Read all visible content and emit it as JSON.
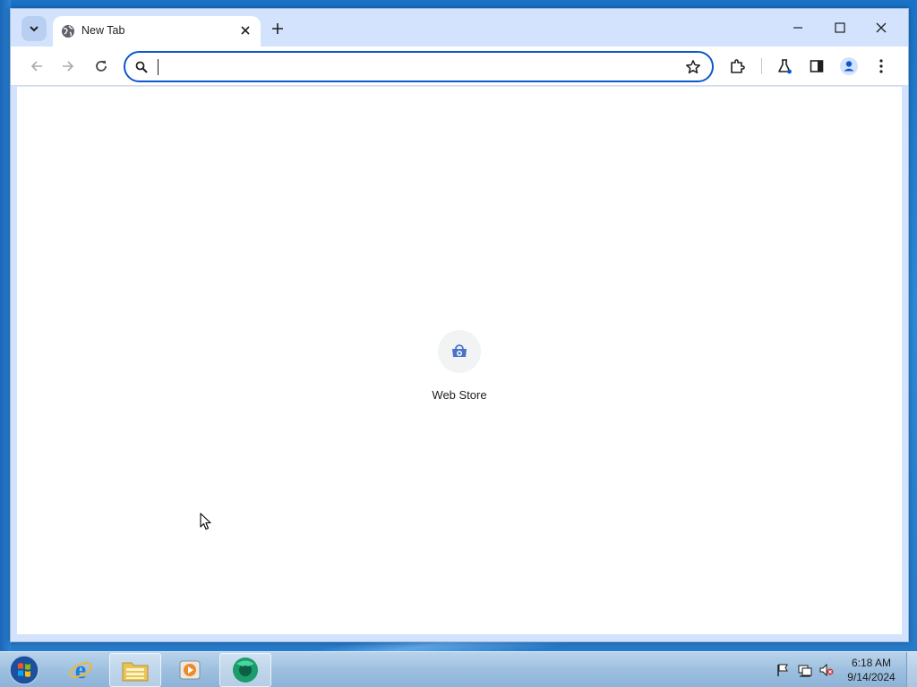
{
  "browser": {
    "tab": {
      "title": "New Tab"
    },
    "omnibox": {
      "value": "",
      "placeholder": ""
    },
    "icons": {
      "tab_search": "chevron-down-icon",
      "tab_favicon": "globe-icon",
      "tab_close": "close-icon",
      "new_tab": "plus-icon",
      "minimize": "minimize-icon",
      "maximize": "maximize-icon",
      "close": "close-icon",
      "back": "back-arrow-icon",
      "forward": "forward-arrow-icon",
      "reload": "reload-icon",
      "search": "search-icon",
      "bookmark": "star-icon",
      "extensions": "puzzle-icon",
      "labs": "flask-icon",
      "side_panel": "side-panel-icon",
      "profile": "profile-icon",
      "menu": "kebab-menu-icon"
    }
  },
  "newtab": {
    "shortcuts": [
      {
        "label": "Web Store",
        "icon": "web-store-icon"
      }
    ]
  },
  "taskbar": {
    "apps": [
      {
        "name": "Internet Explorer",
        "icon": "ie-icon"
      },
      {
        "name": "File Explorer",
        "icon": "folder-icon"
      },
      {
        "name": "Media Player",
        "icon": "media-player-icon"
      },
      {
        "name": "Chrome",
        "icon": "chrome-icon"
      }
    ],
    "clock": {
      "time": "6:18 AM",
      "date": "9/14/2024"
    }
  },
  "colors": {
    "accent": "#0b57d0",
    "tabstrip": "#d3e3fd",
    "desktop": "#2b8ad8"
  }
}
